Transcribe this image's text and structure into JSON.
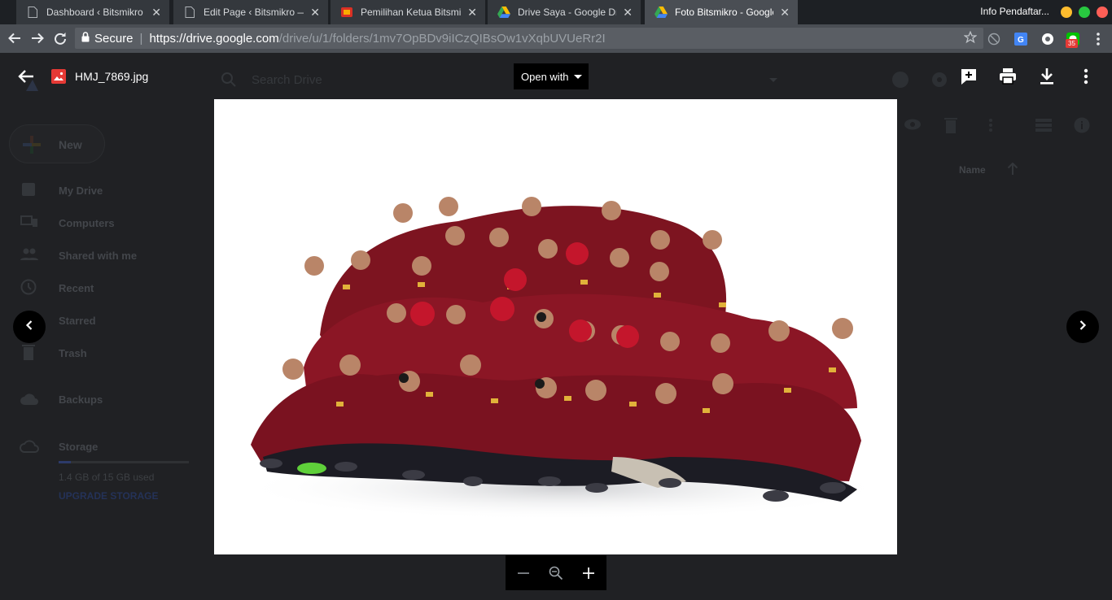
{
  "browser": {
    "tabs": [
      {
        "title": "Dashboard ‹ Bitsmikro — W",
        "icon": "page-icon"
      },
      {
        "title": "Edit Page ‹ Bitsmikro — W",
        "icon": "page-icon"
      },
      {
        "title": "Pemilihan Ketua Bitsmikro",
        "icon": "bitsmikro-logo-icon"
      },
      {
        "title": "Drive Saya - Google Drive",
        "icon": "google-drive-icon"
      },
      {
        "title": "Foto Bitsmikro - Google D",
        "icon": "google-drive-icon",
        "active": true
      }
    ],
    "profile_name": "Info Pendaftar...",
    "security_label": "Secure",
    "url_scheme_host": "https://drive.google.com",
    "url_path": "/drive/u/1/folders/1mv7OpBDv9iICzQIBsOw1vXqbUVUeRr2I",
    "extension_badge": "35",
    "colors": {
      "window_close": "#ff5f57",
      "window_min": "#febc2e",
      "window_max": "#28c840"
    }
  },
  "drive": {
    "search_placeholder": "Search Drive",
    "new_label": "New",
    "nav": [
      {
        "label": "My Drive",
        "icon": "my-drive-icon"
      },
      {
        "label": "Computers",
        "icon": "computers-icon"
      },
      {
        "label": "Shared with me",
        "icon": "shared-icon"
      },
      {
        "label": "Recent",
        "icon": "clock-icon"
      },
      {
        "label": "Starred",
        "icon": "star-icon"
      },
      {
        "label": "Trash",
        "icon": "trash-icon"
      },
      {
        "label": "Backups",
        "icon": "cloud-icon"
      }
    ],
    "storage_label": "Storage",
    "storage_used": "1.4 GB of 15 GB used",
    "storage_fraction": 0.093,
    "upgrade_label": "UPGRADE STORAGE",
    "sort_label": "Name"
  },
  "viewer": {
    "file_name": "HMJ_7869.jpg",
    "open_with_label": "Open with",
    "actions": [
      "add-to-drive-icon",
      "print-icon",
      "download-icon",
      "more-vert-icon"
    ],
    "zoom_controls": [
      "zoom-out-icon",
      "zoom-reset-icon",
      "zoom-in-icon"
    ]
  }
}
